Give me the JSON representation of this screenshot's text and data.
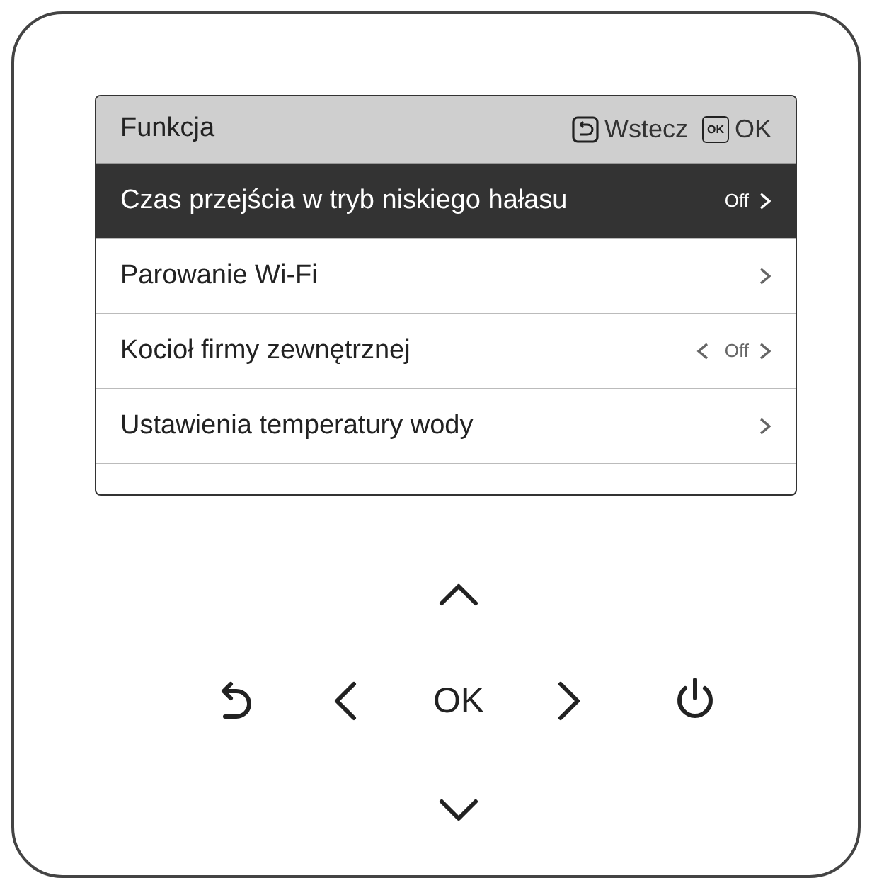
{
  "screen": {
    "title": "Funkcja",
    "hints": [
      {
        "kind": "back",
        "label": "Wstecz"
      },
      {
        "kind": "ok",
        "key": "OK",
        "label": "OK"
      }
    ],
    "items": [
      {
        "label": "Czas przejścia w tryb niskiego hałasu",
        "value": "Off",
        "kind": "arrow",
        "selected": true
      },
      {
        "label": "Parowanie Wi-Fi",
        "kind": "arrow",
        "selected": false
      },
      {
        "label": "Kocioł firmy zewnętrznej",
        "value": "Off",
        "kind": "toggle",
        "selected": false
      },
      {
        "label": "Ustawienia temperatury wody",
        "kind": "arrow",
        "selected": false
      }
    ]
  },
  "keypad": {
    "center_label": "OK"
  }
}
